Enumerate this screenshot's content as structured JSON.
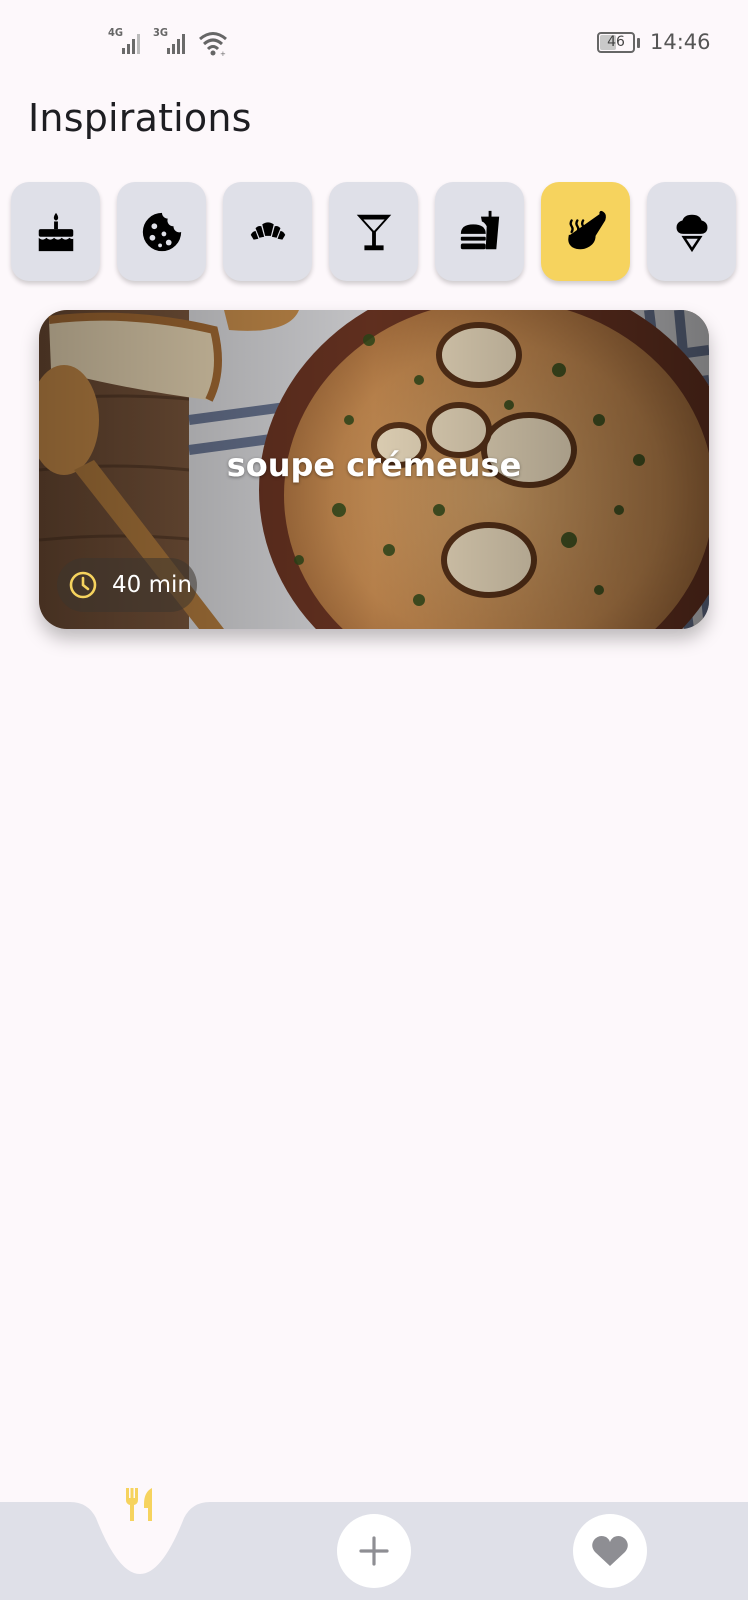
{
  "status_bar": {
    "network1": "4G",
    "network2": "3G",
    "battery": "46",
    "time": "14:46"
  },
  "page": {
    "title": "Inspirations"
  },
  "categories": [
    {
      "icon": "birthday-cake-icon",
      "active": false
    },
    {
      "icon": "cookie-icon",
      "active": false
    },
    {
      "icon": "croissant-icon",
      "active": false
    },
    {
      "icon": "cocktail-icon",
      "active": false
    },
    {
      "icon": "fast-food-icon",
      "active": false
    },
    {
      "icon": "soup-ladle-icon",
      "active": true
    },
    {
      "icon": "ice-cream-icon",
      "active": false
    }
  ],
  "recipes": [
    {
      "title": "soupe crémeuse",
      "time": "40 min"
    }
  ],
  "bottom_nav": [
    {
      "icon": "restaurant-icon",
      "active": true
    },
    {
      "icon": "add-icon",
      "active": false
    },
    {
      "icon": "heart-icon",
      "active": false
    }
  ],
  "colors": {
    "background": "#fdf8fb",
    "chip": "#dfe0e8",
    "accent": "#f6d35e",
    "nav_background": "#dfe0e8"
  }
}
